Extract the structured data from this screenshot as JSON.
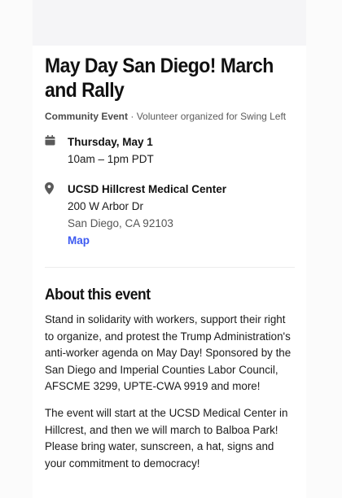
{
  "event": {
    "title": "May Day San Diego! March and Rally",
    "category": "Community Event",
    "separator": " · ",
    "organizer": "Volunteer organized for Swing Left",
    "date": "Thursday, May 1",
    "time": "10am – 1pm PDT",
    "location_name": "UCSD Hillcrest Medical Center",
    "address_line1": "200 W Arbor Dr",
    "address_line2": "San Diego, CA 92103",
    "map_link": "Map"
  },
  "about": {
    "heading": "About this event",
    "paragraph1": "Stand in solidarity with workers, support their right to organize, and protest the Trump Administration's anti-worker agenda on May Day! Sponsored by the San Diego and Imperial Counties Labor Council, AFSCME 3299, UPTE-CWA 9919 and more!",
    "paragraph2": "The event will start at the UCSD Medical Center in Hillcrest, and then we will march to Balboa Park! Please bring water, sunscreen, a hat, signs and your commitment to democracy!"
  },
  "icons": {
    "date": "calendar-icon",
    "location": "map-pin-icon"
  },
  "colors": {
    "link": "#3d5af1",
    "background": "#fbfbfb",
    "card": "#ffffff"
  }
}
